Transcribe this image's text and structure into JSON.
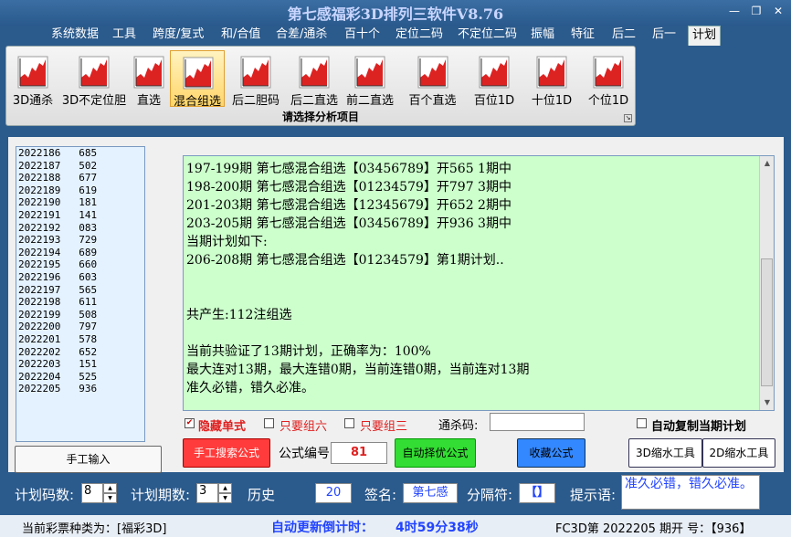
{
  "window": {
    "title": "第七感福彩3D排列三软件V8.76",
    "min_glyph": "—",
    "max_glyph": "❐",
    "close_glyph": "✕"
  },
  "menu": {
    "tabs": [
      "系统数据",
      "工具",
      "跨度/复式",
      "和/合值",
      "合差/通杀",
      "百十个",
      "定位二码",
      "不定位二码",
      "振幅",
      "特征",
      "后二",
      "后一",
      "计划"
    ],
    "active_index": 12
  },
  "ribbon": {
    "items": [
      "3D通杀",
      "3D不定位胆",
      "直选",
      "混合组选",
      "后二胆码",
      "后二直选",
      "前二直选",
      "百个直选",
      "百位1D",
      "十位1D",
      "个位1D"
    ],
    "active_index": 3,
    "caption": "请选择分析项目",
    "launcher_glyph": "↘"
  },
  "history": {
    "rows": [
      [
        "2022186",
        "685"
      ],
      [
        "2022187",
        "502"
      ],
      [
        "2022188",
        "677"
      ],
      [
        "2022189",
        "619"
      ],
      [
        "2022190",
        "181"
      ],
      [
        "2022191",
        "141"
      ],
      [
        "2022192",
        "083"
      ],
      [
        "2022193",
        "729"
      ],
      [
        "2022194",
        "689"
      ],
      [
        "2022195",
        "660"
      ],
      [
        "2022196",
        "603"
      ],
      [
        "2022197",
        "565"
      ],
      [
        "2022198",
        "611"
      ],
      [
        "2022199",
        "508"
      ],
      [
        "2022200",
        "797"
      ],
      [
        "2022201",
        "578"
      ],
      [
        "2022202",
        "652"
      ],
      [
        "2022203",
        "151"
      ],
      [
        "2022204",
        "525"
      ],
      [
        "2022205",
        "936"
      ]
    ]
  },
  "manual_input_label": "手工输入",
  "output": {
    "lines": [
      "197-199期 第七感混合组选【03456789】开565 1期中",
      "198-200期 第七感混合组选【01234579】开797 3期中",
      "201-203期 第七感混合组选【12345679】开652 2期中",
      "203-205期 第七感混合组选【03456789】开936 3期中",
      "当期计划如下:",
      "206-208期 第七感混合组选【01234579】第1期计划..",
      "",
      "",
      "共产生:112注组选",
      "",
      "当前共验证了13期计划，正确率为：100%",
      "最大连对13期，最大连错0期，当前连错0期，当前连对13期",
      "准久必错，错久必准。"
    ],
    "scroll_up": "▲",
    "scroll_down": "▼"
  },
  "options": {
    "hide_single": {
      "label": "隐藏单式",
      "checked": true
    },
    "only_group6": {
      "label": "只要组六",
      "checked": false
    },
    "only_group3": {
      "label": "只要组三",
      "checked": false
    },
    "kill_code_label": "通杀码:",
    "kill_code_value": "",
    "auto_copy": {
      "label": "自动复制当期计划",
      "checked": false
    },
    "check_mark": "✔"
  },
  "buttons": {
    "manual_search": "手工搜索公式",
    "auto_select": "自动择优公式",
    "favorite": "收藏公式",
    "tool_3d": "3D缩水工具",
    "tool_2d": "2D缩水工具"
  },
  "formula": {
    "label": "公式编号:",
    "value": "81"
  },
  "settings": {
    "code_count_label": "计划码数:",
    "code_count_value": "8",
    "period_count_label": "计划期数:",
    "period_count_value": "3",
    "history_label": "历史",
    "history_value": "20",
    "signature_label": "签名:",
    "signature_value": "第七感",
    "separator_label": "分隔符:",
    "separator_value": "【】",
    "hint_label": "提示语:",
    "hint_value": "准久必错，错久必准。",
    "spin_up": "▲",
    "spin_down": "▼"
  },
  "status": {
    "lottery_type": "当前彩票种类为：[福彩3D]",
    "countdown_label": "自动更新倒计时：",
    "countdown_value": "4时59分38秒",
    "draw_info": "FC3D第 2022205 期开  号：【936】"
  },
  "colors": {
    "accent_red": "#e02020",
    "green_panel": "#ccffcc",
    "history_bg": "#e4f2ff",
    "countdown": "#2244ff"
  }
}
